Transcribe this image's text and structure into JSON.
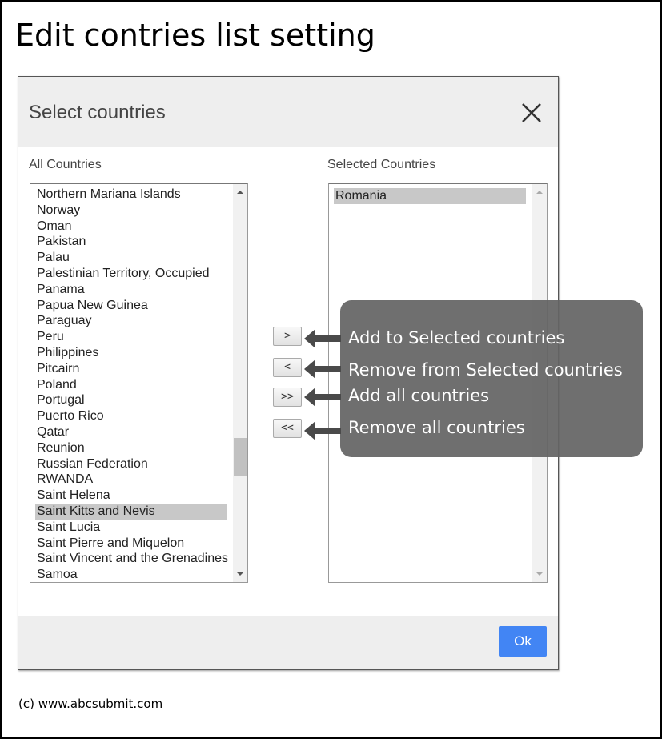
{
  "page": {
    "title": "Edit contries list setting",
    "copyright": "(c) www.abcsubmit.com"
  },
  "dialog": {
    "title": "Select countries",
    "close_icon": "close-x-icon",
    "all_countries_label": "All Countries",
    "selected_countries_label": "Selected Countries",
    "all_countries": [
      "Northern Mariana Islands",
      "Norway",
      "Oman",
      "Pakistan",
      "Palau",
      "Palestinian Territory, Occupied",
      "Panama",
      "Papua New Guinea",
      "Paraguay",
      "Peru",
      "Philippines",
      "Pitcairn",
      "Poland",
      "Portugal",
      "Puerto Rico",
      "Qatar",
      "Reunion",
      "Russian Federation",
      "RWANDA",
      "Saint Helena",
      "Saint Kitts and Nevis",
      "Saint Lucia",
      "Saint Pierre and Miquelon",
      "Saint Vincent and the Grenadines",
      "Samoa"
    ],
    "all_countries_selected": "Saint Kitts and Nevis",
    "all_countries_scroll_position": 0.72,
    "selected_countries": [
      "Romania"
    ],
    "selected_countries_highlighted": "Romania",
    "buttons": {
      "add": ">",
      "remove": "<",
      "add_all": ">>",
      "remove_all": "<<",
      "ok": "Ok"
    },
    "colors": {
      "ok_button": "#4285f4",
      "header_bg": "#eeeeee",
      "selection_bg": "#c8c8c8"
    }
  },
  "annotations": {
    "add": "Add to Selected countries",
    "remove": "Remove from Selected countries",
    "add_all": "Add all countries",
    "remove_all": "Remove all countries"
  }
}
